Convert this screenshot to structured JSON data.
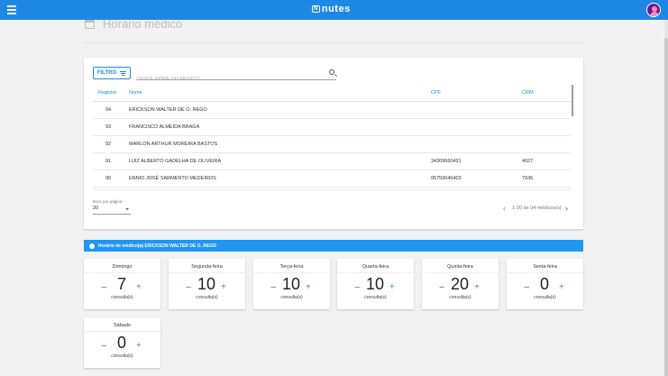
{
  "app": {
    "logo_badge": "N",
    "logo_text": "nutes"
  },
  "page": {
    "title": "Horário médico"
  },
  "filter": {
    "button_label": "FILTRO",
    "search_placeholder": "DIGITE NOME DO MÉDICO"
  },
  "table": {
    "headers": {
      "registro": "Registro",
      "nome": "Nome",
      "cpf": "CPF",
      "crm": "CRM"
    },
    "rows": [
      {
        "registro": "94",
        "nome": "ERICKSON WALTER DE O. REGO",
        "cpf": "",
        "crm": ""
      },
      {
        "registro": "93",
        "nome": "FRANCISCO ALMEIDA BRAGA",
        "cpf": "",
        "crm": ""
      },
      {
        "registro": "92",
        "nome": "MARLON ARTHUR MOREIRA BASTOS",
        "cpf": "",
        "crm": ""
      },
      {
        "registro": "91",
        "nome": "LUIZ ALBERTO GADELHA DE OLIVEIRA",
        "cpf": "34309660491",
        "crm": "4027"
      },
      {
        "registro": "90",
        "nome": "ENNIO JOSÉ SARMENTO MEDEIROS",
        "cpf": "05759046403",
        "crm": "7936"
      }
    ]
  },
  "pagination": {
    "items_per_page_label": "Itens por página",
    "items_per_page": "20",
    "range_text": "1-20 de 94 médicos(s)"
  },
  "banner": {
    "text": "Horário de médico(a) ERICKSON WALTER DE O. REGO"
  },
  "schedule": {
    "unit_label": "consulta(s)",
    "minus": "−",
    "plus": "+",
    "days": [
      {
        "name": "Domingo",
        "count": "7"
      },
      {
        "name": "Segunda-feira",
        "count": "10"
      },
      {
        "name": "Terça-feira",
        "count": "10"
      },
      {
        "name": "Quarta-feira",
        "count": "10"
      },
      {
        "name": "Quinta-feira",
        "count": "20"
      },
      {
        "name": "Sexta-feira",
        "count": "0"
      },
      {
        "name": "Sábado",
        "count": "0"
      }
    ]
  }
}
